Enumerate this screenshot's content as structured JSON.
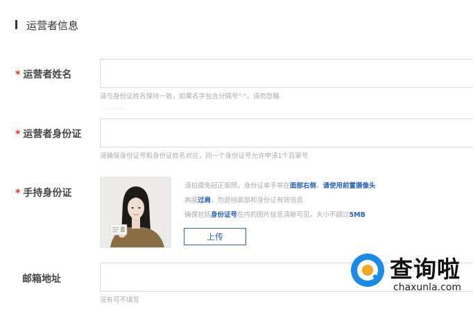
{
  "section": {
    "title": "运营者信息"
  },
  "fields": {
    "name": {
      "required_mark": "*",
      "label": "运营者姓名",
      "value": "",
      "hint": "请与身份证姓名保持一致，如果名字包含分隔号\"·\"，请勿忽略"
    },
    "id_card": {
      "required_mark": "*",
      "label": "运营者身份证",
      "value": "",
      "hint": "请确保身份证号和身份证姓名对应，同一个身份证号允许申请1个百家号"
    },
    "hand_id": {
      "required_mark": "*",
      "label": "手持身份证",
      "instructions": {
        "line1_a": "请拍摄免冠正面照，身份证单手举在",
        "line1_b": "面部右侧",
        "line1_c": "，",
        "line1_d": "请使用前置摄像头",
        "line2_a": "高度",
        "line2_b": "过肩",
        "line2_c": "，勿遮挡面部和身份证有效信息",
        "line3_a": "确保包括",
        "line3_b": "身份证号",
        "line3_c": "在内的图片信息清晰可见，大小不超过",
        "line3_d": "5MB"
      },
      "upload_label": "上传"
    },
    "email": {
      "label": "邮箱地址",
      "value": "",
      "hint": "没有可不填写"
    }
  },
  "watermark": {
    "brand": "查询啦",
    "url": "chaxunla.com"
  },
  "colors": {
    "accent": "#2d64b3",
    "required": "#d9321f",
    "hint": "#aaaaaa"
  }
}
